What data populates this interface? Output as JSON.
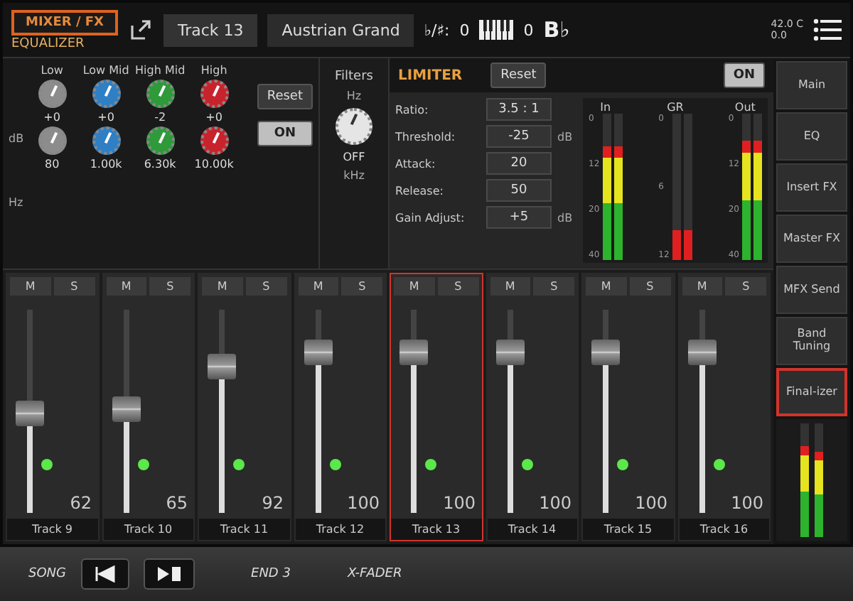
{
  "header": {
    "mode_tab": {
      "label": "MIXER / FX",
      "selected": true
    },
    "page_title": "EQUALIZER",
    "track_tab": "Track 13",
    "sound_name": "Austrian Grand",
    "transpose_label": "♭/♯:",
    "transpose_value": "0",
    "octave_value": "0",
    "key": "B♭",
    "temperature": "42.0 C",
    "status_value": "0.0"
  },
  "equalizer": {
    "reset": "Reset",
    "on_button": {
      "label": "ON",
      "on": true
    },
    "gain_unit": "dB",
    "freq_unit": "Hz",
    "bands": [
      {
        "label": "Low",
        "color": "#8c8c8c",
        "gain": "+0",
        "frequency": "80"
      },
      {
        "label": "Low Mid",
        "color": "#2f7fc4",
        "gain": "+0",
        "frequency": "1.00k"
      },
      {
        "label": "High Mid",
        "color": "#2e9a3a",
        "gain": "-2",
        "frequency": "6.30k"
      },
      {
        "label": "High",
        "color": "#c8232c",
        "gain": "+0",
        "frequency": "10.00k"
      }
    ]
  },
  "filters": {
    "title": "Filters",
    "low_unit": "Hz",
    "high_unit": "kHz",
    "value": "OFF"
  },
  "limiter": {
    "title": "LIMITER",
    "reset": "Reset",
    "on_button": {
      "label": "ON",
      "on": true
    },
    "params": [
      {
        "label": "Ratio:",
        "value": "3.5 : 1"
      },
      {
        "label": "Threshold:",
        "value": "-25",
        "unit": "dB"
      },
      {
        "label": "Attack:",
        "value": "20"
      },
      {
        "label": "Release:",
        "value": "50"
      },
      {
        "label": "Gain Adjust:",
        "value": "+5",
        "unit": "dB"
      }
    ],
    "meters": [
      {
        "label": "In",
        "kind": "level",
        "scale": [
          "0",
          "12",
          "20",
          "40"
        ],
        "bars": [
          {
            "level": 0.78
          },
          {
            "level": 0.78
          }
        ]
      },
      {
        "label": "GR",
        "kind": "reduction",
        "scale": [
          "0",
          "6",
          "12"
        ],
        "bars": [
          {
            "level": 0.2
          },
          {
            "level": 0.2
          }
        ]
      },
      {
        "label": "Out",
        "kind": "level",
        "scale": [
          "0",
          "12",
          "20",
          "40"
        ],
        "bars": [
          {
            "level": 0.82
          },
          {
            "level": 0.82
          }
        ]
      }
    ]
  },
  "side_tabs": [
    {
      "label": "Main",
      "selected": false
    },
    {
      "label": "EQ",
      "selected": false
    },
    {
      "label": "Insert FX",
      "selected": false
    },
    {
      "label": "Master FX",
      "selected": false
    },
    {
      "label": "MFX Send",
      "selected": false
    },
    {
      "label": "Band Tuning",
      "selected": false
    },
    {
      "label": "Final-izer",
      "selected": true
    }
  ],
  "side_meter": {
    "bars": [
      {
        "level": 0.8
      },
      {
        "level": 0.75
      }
    ]
  },
  "channels": [
    {
      "name": "Track 9",
      "mute": "M",
      "solo": "S",
      "value": "62",
      "level": 0.49,
      "selected": false
    },
    {
      "name": "Track 10",
      "mute": "M",
      "solo": "S",
      "value": "65",
      "level": 0.51,
      "selected": false
    },
    {
      "name": "Track 11",
      "mute": "M",
      "solo": "S",
      "value": "92",
      "level": 0.72,
      "selected": false
    },
    {
      "name": "Track 12",
      "mute": "M",
      "solo": "S",
      "value": "100",
      "level": 0.79,
      "selected": false
    },
    {
      "name": "Track 13",
      "mute": "M",
      "solo": "S",
      "value": "100",
      "level": 0.79,
      "selected": true
    },
    {
      "name": "Track 14",
      "mute": "M",
      "solo": "S",
      "value": "100",
      "level": 0.79,
      "selected": false
    },
    {
      "name": "Track 15",
      "mute": "M",
      "solo": "S",
      "value": "100",
      "level": 0.79,
      "selected": false
    },
    {
      "name": "Track 16",
      "mute": "M",
      "solo": "S",
      "value": "100",
      "level": 0.79,
      "selected": false
    }
  ],
  "hardware": {
    "labels": [
      "SONG",
      "END 3",
      "X-FADER"
    ]
  }
}
